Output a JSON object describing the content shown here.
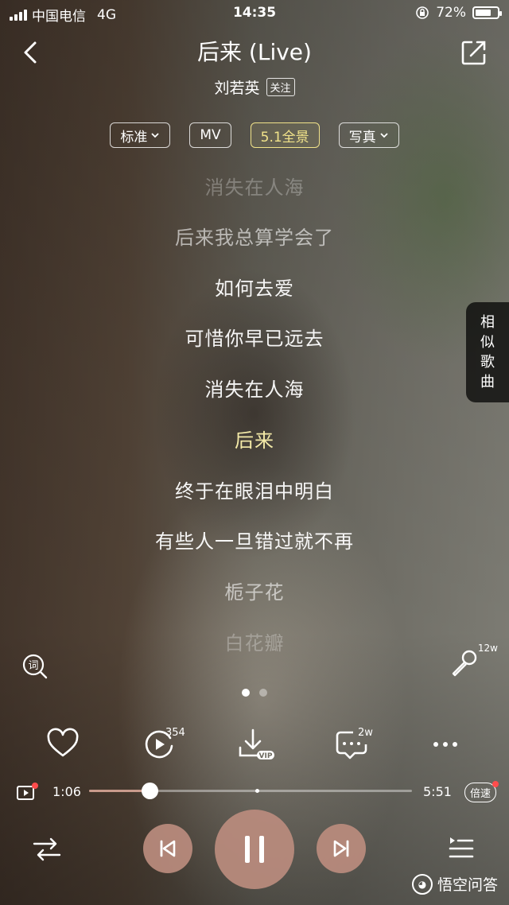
{
  "status_bar": {
    "carrier": "中国电信",
    "network": "4G",
    "time": "14:35",
    "battery": "72%"
  },
  "header": {
    "title": "后来 (Live)",
    "artist": "刘若英",
    "follow_label": "关注"
  },
  "chips": [
    {
      "label": "标准",
      "dropdown": true,
      "active": false
    },
    {
      "label": "MV",
      "dropdown": false,
      "active": false
    },
    {
      "label": "5.1全景",
      "dropdown": false,
      "active": true
    },
    {
      "label": "写真",
      "dropdown": true,
      "active": false
    }
  ],
  "lyrics": [
    {
      "text": "消失在人海",
      "style": "faint"
    },
    {
      "text": "后来我总算学会了",
      "style": "mid"
    },
    {
      "text": "如何去爱",
      "style": "normal"
    },
    {
      "text": "可惜你早已远去",
      "style": "normal"
    },
    {
      "text": "消失在人海",
      "style": "normal"
    },
    {
      "text": "后来",
      "style": "current"
    },
    {
      "text": "终于在眼泪中明白",
      "style": "normal"
    },
    {
      "text": "有些人一旦错过就不再",
      "style": "normal"
    },
    {
      "text": "栀子花",
      "style": "mid"
    },
    {
      "text": "白花瓣",
      "style": "faint"
    }
  ],
  "similar_songs_label": [
    "相",
    "似",
    "歌",
    "曲"
  ],
  "lyric_search_icon_char": "词",
  "mic_count": "12w",
  "page_dots": {
    "total": 2,
    "active": 0
  },
  "actions": {
    "play_count": "354",
    "comment_count": "2w",
    "download_badge": "VIP"
  },
  "progress": {
    "current": "1:06",
    "total": "5:51",
    "fraction": 0.188,
    "speed_label": "倍速"
  },
  "watermark": "悟空问答",
  "colors": {
    "accent_yellow": "#f1e38a",
    "current_lyric": "#f4eaa8",
    "control_bg": "#bb8c7e",
    "progress_fill": "#c99b8c",
    "red_dot": "#ff4c4c"
  }
}
